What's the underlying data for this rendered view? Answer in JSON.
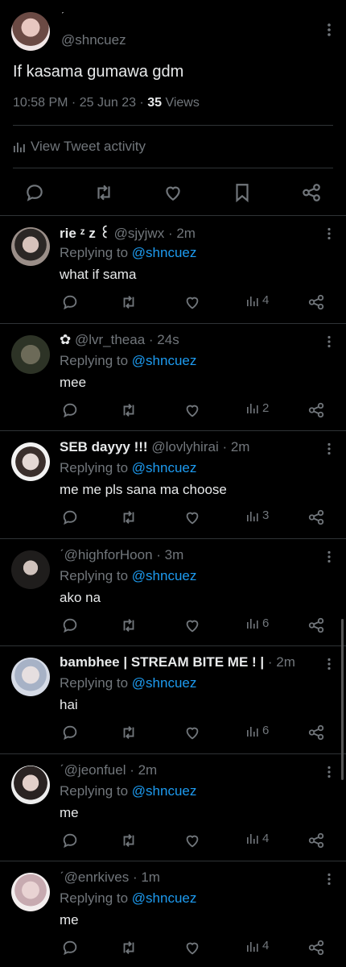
{
  "main_tweet": {
    "display_name": "ˊ",
    "handle": "@shncuez",
    "text": "If kasama gumawa gdm",
    "time": "10:58 PM · 25 Jun 23 · ",
    "views_count": "35",
    "views_label": " Views",
    "activity_label": "View Tweet activity"
  },
  "replies": [
    {
      "name": "rie ᶻ z ꒰",
      "handle": "@sjyjwx",
      "time": "2m",
      "replying_label": "Replying to ",
      "mention": "@shncuez",
      "text": "what if sama",
      "views": "4"
    },
    {
      "name": "✿",
      "handle": "@lvr_theaa",
      "time": "24s",
      "replying_label": "Replying to ",
      "mention": "@shncuez",
      "text": "mee",
      "views": "2"
    },
    {
      "name": "SEB dayyy !!!",
      "handle": "@lovlyhirai",
      "time": "2m",
      "replying_label": "Replying to ",
      "mention": "@shncuez",
      "text": "me me pls sana ma choose",
      "views": "3"
    },
    {
      "name": "ˊ",
      "handle": "@highforHoon",
      "time": "3m",
      "replying_label": "Replying to ",
      "mention": "@shncuez",
      "text": "ako na",
      "views": "6"
    },
    {
      "name": "bambhee | STREAM BITE ME ! |",
      "handle": "",
      "time": "2m",
      "replying_label": "Replying to ",
      "mention": "@shncuez",
      "text": "hai",
      "views": "6"
    },
    {
      "name": "ˊ",
      "handle": "@jeonfuel",
      "time": "2m",
      "replying_label": "Replying to ",
      "mention": "@shncuez",
      "text": "me",
      "views": "4"
    },
    {
      "name": "ˊ",
      "handle": "@enrkives",
      "time": "1m",
      "replying_label": "Replying to ",
      "mention": "@shncuez",
      "text": "me",
      "views": "4"
    }
  ],
  "colors": {
    "background": "#000000",
    "text": "#e7e9ea",
    "muted": "#71767b",
    "link": "#1d9bf0",
    "divider": "#2f3336"
  },
  "icons": [
    "more-icon",
    "reply-icon",
    "retweet-icon",
    "like-icon",
    "bookmark-icon",
    "share-icon",
    "views-icon"
  ]
}
